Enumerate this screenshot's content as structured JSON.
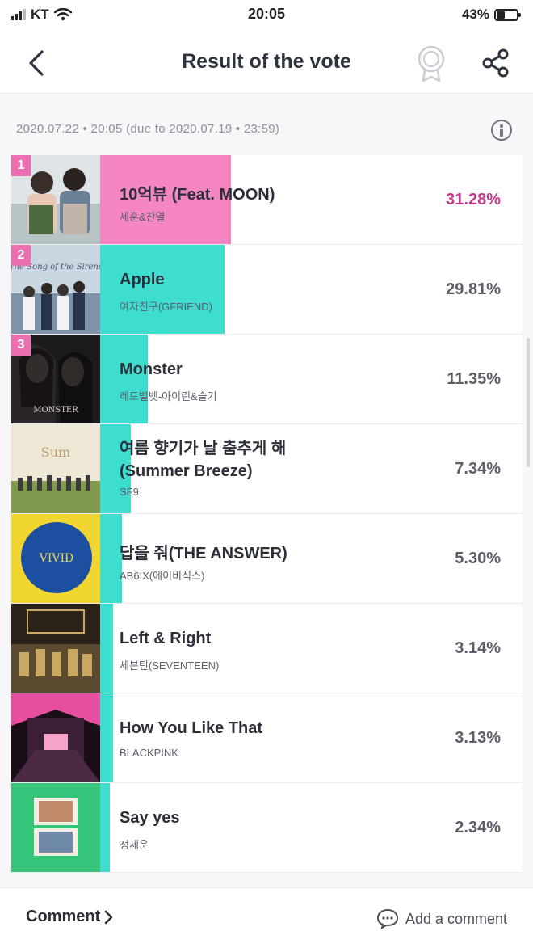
{
  "status_bar": {
    "carrier": "KT",
    "time": "20:05",
    "battery_percent": "43%",
    "battery_level": 0.43,
    "icons": [
      "signal-icon",
      "wifi-icon",
      "battery-icon"
    ]
  },
  "header": {
    "title": "Result of the vote",
    "icons": [
      "back-arrow-icon",
      "medal-icon",
      "share-icon"
    ]
  },
  "meta": {
    "timestamp_text": "2020.07.22 • 20:05 (due to 2020.07.19 • 23:59)",
    "info_icon": "info-icon"
  },
  "colors": {
    "top_bar": "#f685c4",
    "bar": "#3dddd0",
    "top_percent": "#c33a8e",
    "rank_badge": "#ec6fb2"
  },
  "items": [
    {
      "rank": "1",
      "title": "10억뷰 (Feat. MOON)",
      "artist": "세훈&찬열",
      "percent": "31.28%",
      "value": 31.28
    },
    {
      "rank": "2",
      "title": "Apple",
      "artist": "여자친구(GFRIEND)",
      "percent": "29.81%",
      "value": 29.81
    },
    {
      "rank": "3",
      "title": "Monster",
      "artist": "레드벨벳-아이린&슬기",
      "percent": "11.35%",
      "value": 11.35
    },
    {
      "rank": "",
      "title": "여름 향기가 날 춤추게 해 (Summer Breeze)",
      "artist": "SF9",
      "percent": "7.34%",
      "value": 7.34
    },
    {
      "rank": "",
      "title": "답을 줘(THE ANSWER)",
      "artist": "AB6IX(에이비식스)",
      "percent": "5.30%",
      "value": 5.3
    },
    {
      "rank": "",
      "title": "Left & Right",
      "artist": "세븐틴(SEVENTEEN)",
      "percent": "3.14%",
      "value": 3.14
    },
    {
      "rank": "",
      "title": "How You Like That",
      "artist": "BLACKPINK",
      "percent": "3.13%",
      "value": 3.13
    },
    {
      "rank": "",
      "title": "Say yes",
      "artist": "정세운",
      "percent": "2.34%",
      "value": 2.34
    }
  ],
  "album_art": {
    "vivid_label": "VIVID",
    "monster_label": "MONSTER",
    "summer_label": "Sum",
    "gfriend_label": "The Song of the Sirens"
  },
  "footer": {
    "comment_label": "Comment",
    "add_comment_label": "Add a comment",
    "icons": [
      "chevron-right-icon",
      "comment-bubble-icon"
    ]
  }
}
